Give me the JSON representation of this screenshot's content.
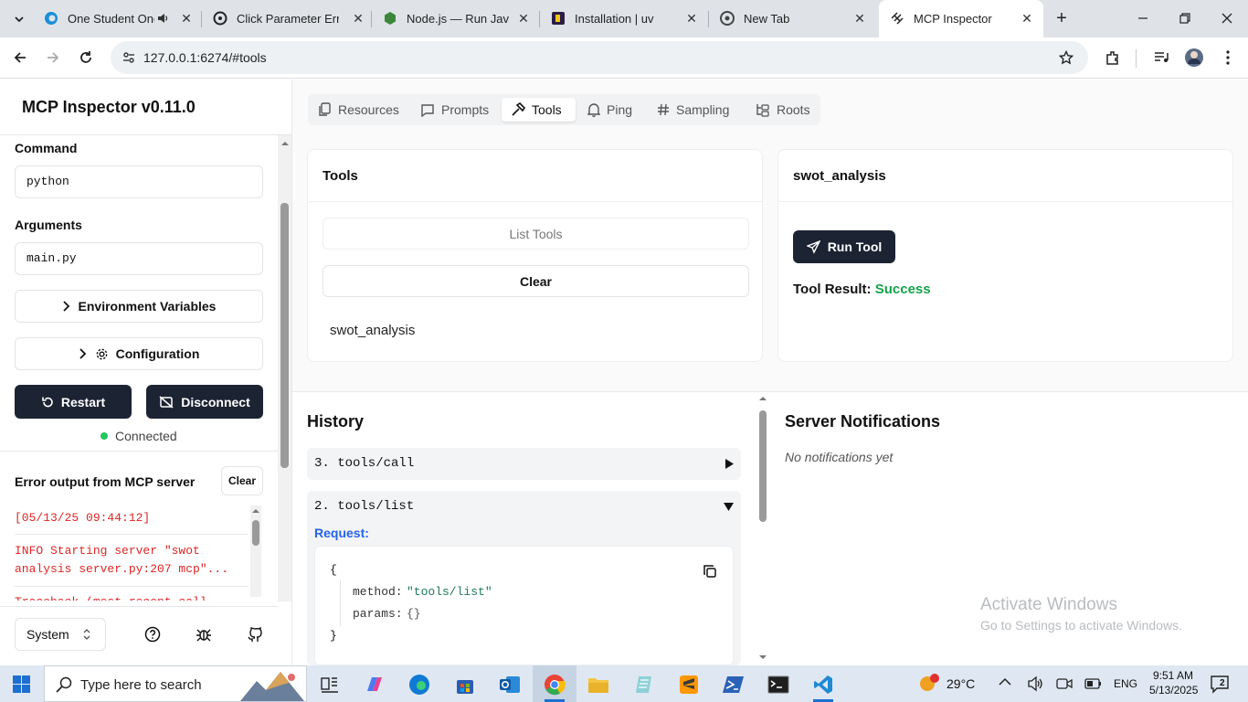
{
  "browser": {
    "tabs": [
      {
        "title": "One Student One",
        "favicon": "edge-swirl-icon",
        "muted_icon": true
      },
      {
        "title": "Click Parameter Error",
        "favicon": "openai-icon"
      },
      {
        "title": "Node.js — Run JavaSc",
        "favicon": "nodejs-icon"
      },
      {
        "title": "Installation | uv",
        "favicon": "uv-icon"
      },
      {
        "title": "New Tab",
        "favicon": "chrome-icon"
      },
      {
        "title": "MCP Inspector",
        "favicon": "mcp-icon",
        "active": true
      }
    ],
    "url": "127.0.0.1:6274/#tools"
  },
  "sidebar": {
    "title": "MCP Inspector v0.11.0",
    "command_label": "Command",
    "command_value": "python",
    "arguments_label": "Arguments",
    "arguments_value": "main.py",
    "env_button": "Environment Variables",
    "config_button": "Configuration",
    "restart_button": "Restart",
    "disconnect_button": "Disconnect",
    "status": "Connected",
    "status_color": "#22c55e",
    "error_title": "Error output from MCP server",
    "error_clear": "Clear",
    "error_lines": [
      "[05/13/25 09:44:12]",
      "INFO Starting server \"swot analysis server.py:207 mcp\"...",
      "Traceback (most recent call"
    ],
    "error_color": "#dc2626",
    "theme_select": "System"
  },
  "main": {
    "tabs": [
      {
        "label": "Resources",
        "icon": "files-icon"
      },
      {
        "label": "Prompts",
        "icon": "message-icon"
      },
      {
        "label": "Tools",
        "icon": "hammer-icon",
        "active": true
      },
      {
        "label": "Ping",
        "icon": "bell-icon"
      },
      {
        "label": "Sampling",
        "icon": "hash-icon"
      },
      {
        "label": "Roots",
        "icon": "folder-tree-icon"
      }
    ],
    "tools_card": {
      "title": "Tools",
      "list_button": "List Tools",
      "clear_button": "Clear",
      "items": [
        "swot_analysis"
      ]
    },
    "detail_card": {
      "title": "swot_analysis",
      "run_button": "Run Tool",
      "result_label": "Tool Result:",
      "result_value": "Success",
      "result_color": "#16a34a"
    },
    "history": {
      "title": "History",
      "items": [
        {
          "label": "3. tools/call",
          "expanded": false
        },
        {
          "label": "2. tools/list",
          "expanded": true
        }
      ],
      "request_label": "Request:",
      "request_json": {
        "open": "{",
        "close": "}",
        "method_key": "method:",
        "method_value": "\"tools/list\"",
        "params_key": "params:",
        "params_value": "{}"
      }
    },
    "notifications": {
      "title": "Server Notifications",
      "empty": "No notifications yet"
    }
  },
  "watermark": {
    "line1": "Activate Windows",
    "line2": "Go to Settings to activate Windows."
  },
  "taskbar": {
    "search_placeholder": "Type here to search",
    "weather": "29°C",
    "language": "ENG",
    "time": "9:51 AM",
    "date": "5/13/2025",
    "notification_count": "2"
  }
}
